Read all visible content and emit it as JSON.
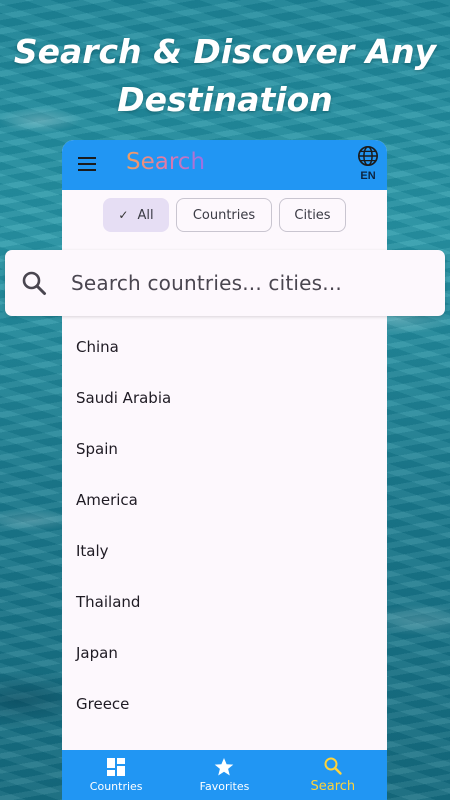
{
  "headline": {
    "line1": "Search & Discover Any",
    "line2": "Destination"
  },
  "appbar": {
    "title": "Search",
    "language": "EN",
    "icons": [
      "menu-icon",
      "globe-icon"
    ]
  },
  "filters": {
    "chips": [
      {
        "label": "All",
        "selected": true
      },
      {
        "label": "Countries",
        "selected": false
      },
      {
        "label": "Cities",
        "selected": false
      }
    ]
  },
  "search": {
    "placeholder": "Search countries... cities..."
  },
  "countries": [
    "China",
    "Saudi Arabia",
    "Spain",
    "America",
    "Italy",
    "Thailand",
    "Japan",
    "Greece"
  ],
  "bottom_nav": {
    "items": [
      {
        "label": "Countries",
        "icon": "grid-icon",
        "active": false
      },
      {
        "label": "Favorites",
        "icon": "star-icon",
        "active": false
      },
      {
        "label": "Search",
        "icon": "search-icon",
        "active": true
      }
    ]
  },
  "colors": {
    "appbar": "#2196f3",
    "active_nav": "#ffd33a",
    "selected_chip": "#e6def4"
  }
}
